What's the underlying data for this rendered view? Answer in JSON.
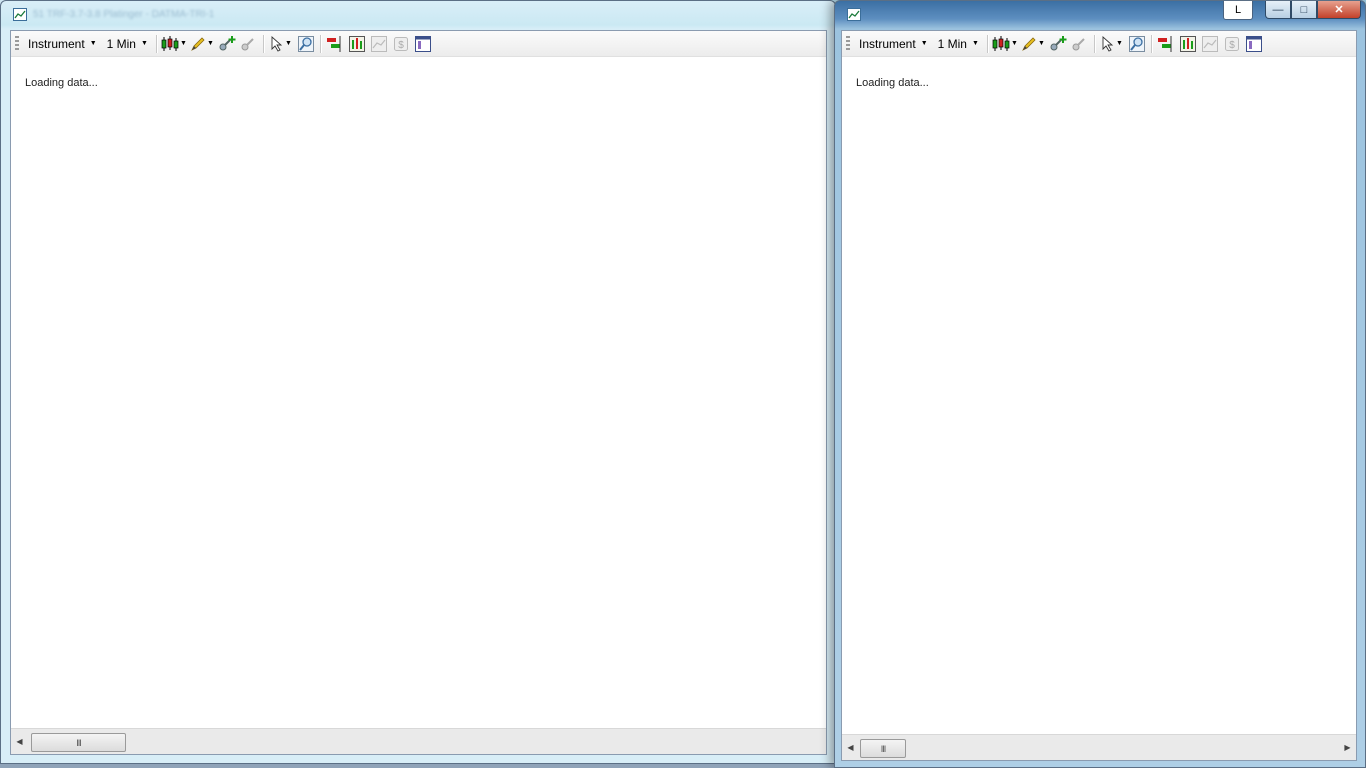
{
  "windows": [
    {
      "id": "left",
      "title": "51 TRF-3.7-3.8 Platinger - DATMA-TRI-1",
      "toolbar": {
        "instrument_label": "Instrument",
        "interval_label": "1 Min"
      },
      "status_text": "Loading data...",
      "scroll_thumb_glyph": "III"
    },
    {
      "id": "right",
      "title": "",
      "toolbar": {
        "instrument_label": "Instrument",
        "interval_label": "1 Min"
      },
      "status_text": "Loading data...",
      "scroll_thumb_glyph": "III",
      "caption": {
        "extra_button_label": "L",
        "minimize_glyph": "—",
        "maximize_glyph": "□",
        "close_glyph": "✕"
      }
    }
  ],
  "icons": {
    "chart_style": "candlestick-icon",
    "draw": "pencil-icon",
    "add_indicator": "add-indicator-icon",
    "remove_indicator": "remove-indicator-icon",
    "cursor": "cursor-icon",
    "zoom": "zoom-icon",
    "strategy": "strategy-icon",
    "data_box": "data-box-icon",
    "chart_trader": "chart-trader-icon",
    "dollar": "dollar-icon",
    "properties": "properties-icon"
  },
  "colors": {
    "candle_green": "#1a9d1a",
    "candle_red": "#d02020",
    "pencil_yellow": "#e8c020",
    "accent_blue": "#3b6fa3"
  }
}
